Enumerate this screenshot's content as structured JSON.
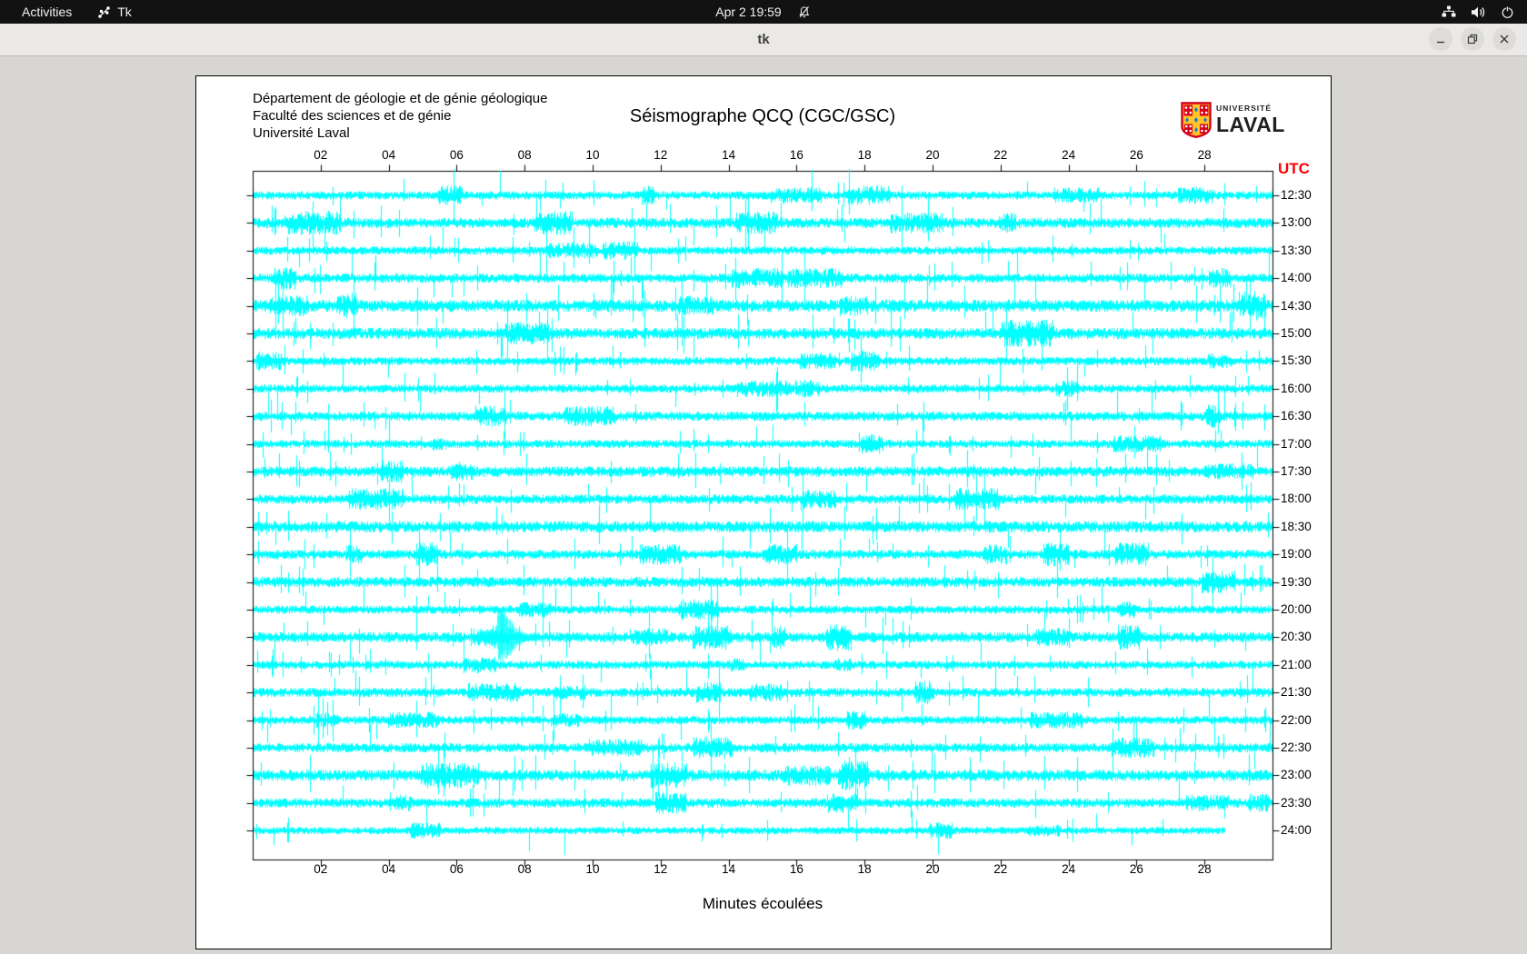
{
  "top_bar": {
    "activities_label": "Activities",
    "app_indicator_label": "Tk",
    "clock": "Apr 2  19:59",
    "icons": {
      "app": "tk-app-icon",
      "notifications": "bell-slash-icon",
      "tray": [
        "network-icon",
        "volume-icon",
        "power-icon"
      ]
    }
  },
  "title_bar": {
    "title": "tk",
    "icons": [
      "minimize-icon",
      "maximize-icon",
      "close-icon"
    ]
  },
  "logo": {
    "top_text": "UNIVERSITÉ",
    "bottom_text": "LAVAL",
    "shield_red": "#d6001c",
    "shield_gold": "#ffc629",
    "shield_blue": "#2a76c6"
  },
  "chart_data": {
    "type": "line",
    "title": "Séismographe QCQ (CGC/GSC)",
    "header_lines": [
      "Département de géologie et de génie géologique",
      "Faculté des sciences et de génie",
      "Université Laval"
    ],
    "xlabel": "Minutes écoulées",
    "right_axis_title": "UTC",
    "x_ticks": [
      "02",
      "04",
      "06",
      "08",
      "10",
      "12",
      "14",
      "16",
      "18",
      "20",
      "22",
      "24",
      "26",
      "28"
    ],
    "x_range_minutes": [
      0,
      30
    ],
    "trace_color": "#00ffff",
    "utc_label_color": "#fb0006",
    "rows": [
      {
        "time": "12:30",
        "amp": 4.0,
        "seed": 11
      },
      {
        "time": "13:00",
        "amp": 5.0,
        "seed": 23
      },
      {
        "time": "13:30",
        "amp": 4.0,
        "seed": 37
      },
      {
        "time": "14:00",
        "amp": 4.5,
        "seed": 41
      },
      {
        "time": "14:30",
        "amp": 6.0,
        "seed": 53
      },
      {
        "time": "15:00",
        "amp": 5.5,
        "seed": 67
      },
      {
        "time": "15:30",
        "amp": 4.0,
        "seed": 71
      },
      {
        "time": "16:00",
        "amp": 4.0,
        "seed": 83
      },
      {
        "time": "16:30",
        "amp": 4.5,
        "seed": 97
      },
      {
        "time": "17:00",
        "amp": 4.0,
        "seed": 101
      },
      {
        "time": "17:30",
        "amp": 5.0,
        "seed": 113
      },
      {
        "time": "18:00",
        "amp": 4.5,
        "seed": 127
      },
      {
        "time": "18:30",
        "amp": 5.5,
        "seed": 139
      },
      {
        "time": "19:00",
        "amp": 4.5,
        "seed": 149
      },
      {
        "time": "19:30",
        "amp": 5.0,
        "seed": 157
      },
      {
        "time": "20:00",
        "amp": 4.0,
        "seed": 163
      },
      {
        "time": "20:30",
        "amp": 5.0,
        "seed": 173
      },
      {
        "time": "21:00",
        "amp": 4.0,
        "seed": 181
      },
      {
        "time": "21:30",
        "amp": 4.5,
        "seed": 191
      },
      {
        "time": "22:00",
        "amp": 4.0,
        "seed": 197
      },
      {
        "time": "22:30",
        "amp": 4.5,
        "seed": 211
      },
      {
        "time": "23:00",
        "amp": 5.5,
        "seed": 223
      },
      {
        "time": "23:30",
        "amp": 4.5,
        "seed": 227
      },
      {
        "time": "24:00",
        "amp": 3.5,
        "seed": 229
      }
    ],
    "last_row_end_minute": 28.6,
    "notable_event": {
      "row_time": "20:30",
      "minute": 7.2
    }
  }
}
